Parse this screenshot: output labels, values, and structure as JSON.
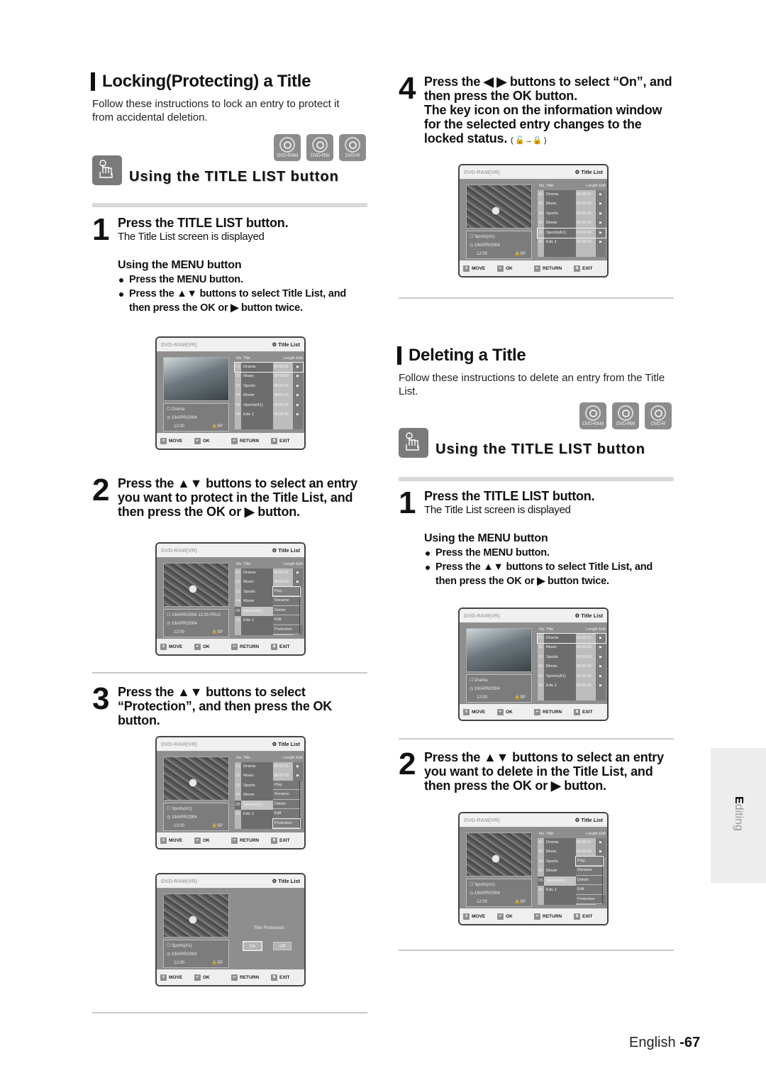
{
  "locking": {
    "title": "Locking(Protecting) a Title",
    "intro": "Follow these instructions to lock an entry to protect it from accidental deletion.",
    "discs": [
      "DVD-RAM",
      "DVD-RW",
      "DVD-R"
    ],
    "using_heading": "Using the TITLE LIST button",
    "step1": {
      "num": "1",
      "title": "Press the TITLE LIST button.",
      "sub": "The Title List screen is displayed",
      "menu_heading": "Using the MENU button",
      "bullets": [
        "Press the MENU button.",
        "Press the ▲▼ buttons to select Title List, and then press the OK or ▶ button twice."
      ]
    },
    "step2": {
      "num": "2",
      "text": "Press the ▲▼ buttons to select an entry you want to protect in the Title List, and then press the OK or ▶ button."
    },
    "step3": {
      "num": "3",
      "text": "Press the ▲▼ buttons to select “Protection”, and then press the OK button."
    },
    "step4": {
      "num": "4",
      "text": "Press the ◀ ▶ buttons to select “On”, and then press the OK button.",
      "text2": "The key icon on the information window for the selected entry changes to the locked status.",
      "icons": "( 🔓→🔒 )"
    }
  },
  "deleting": {
    "title": "Deleting a Title",
    "intro": "Follow these instructions to delete an entry from the Title List.",
    "discs": [
      "DVD-RAM",
      "DVD-RW",
      "DVD-R"
    ],
    "using_heading": "Using the TITLE LIST button",
    "step1": {
      "num": "1",
      "title": "Press the TITLE LIST button.",
      "sub": "The Title List screen is displayed",
      "menu_heading": "Using the MENU button",
      "bullets": [
        "Press the MENU button.",
        "Press the ▲▼ buttons to select Title List, and then press the OK or ▶ button twice."
      ]
    },
    "step2": {
      "num": "2",
      "text": "Press the ▲▼ buttons to select an entry you want to delete in the Title List, and then press the OK or ▶ button."
    }
  },
  "osd": {
    "device": "DVD-RAM(VR)",
    "screen_title": "Title List",
    "headers": {
      "no": "No.",
      "title": "Title",
      "length": "Length",
      "edit": "Edit"
    },
    "rows": [
      {
        "no": "01",
        "title": "Drama",
        "length": "00:00:21"
      },
      {
        "no": "02",
        "title": "Music",
        "length": "00:00:03"
      },
      {
        "no": "03",
        "title": "Sports",
        "length": "00:00:15"
      },
      {
        "no": "04",
        "title": "Movie",
        "length": "00:00:16"
      },
      {
        "no": "05",
        "title": "Sports(A1)",
        "length": "00:06:32"
      },
      {
        "no": "06",
        "title": "Edu 1",
        "length": "00:08:16"
      }
    ],
    "edit_arrow": "▶",
    "popup": [
      "Play",
      "Rename",
      "Delete",
      "Edit",
      "Protection"
    ],
    "protection_label": "Title Protection:",
    "on": "On",
    "off": "Off",
    "date": "19/APR/2004",
    "time": "12:00",
    "mode_unlocked": "🔓SP",
    "mode_locked": "🔒SP",
    "info_drama": "Drama",
    "info_sports": "Sports(A1)",
    "info_record": "19/APR/2004 12:00 PR12",
    "footer": {
      "move": "MOVE",
      "ok": "OK",
      "return": "RETURN",
      "exit": "EXIT"
    }
  },
  "side_tab": {
    "first": "E",
    "rest": "diting"
  },
  "page_footer": {
    "lang": "English ",
    "num": "-67"
  }
}
